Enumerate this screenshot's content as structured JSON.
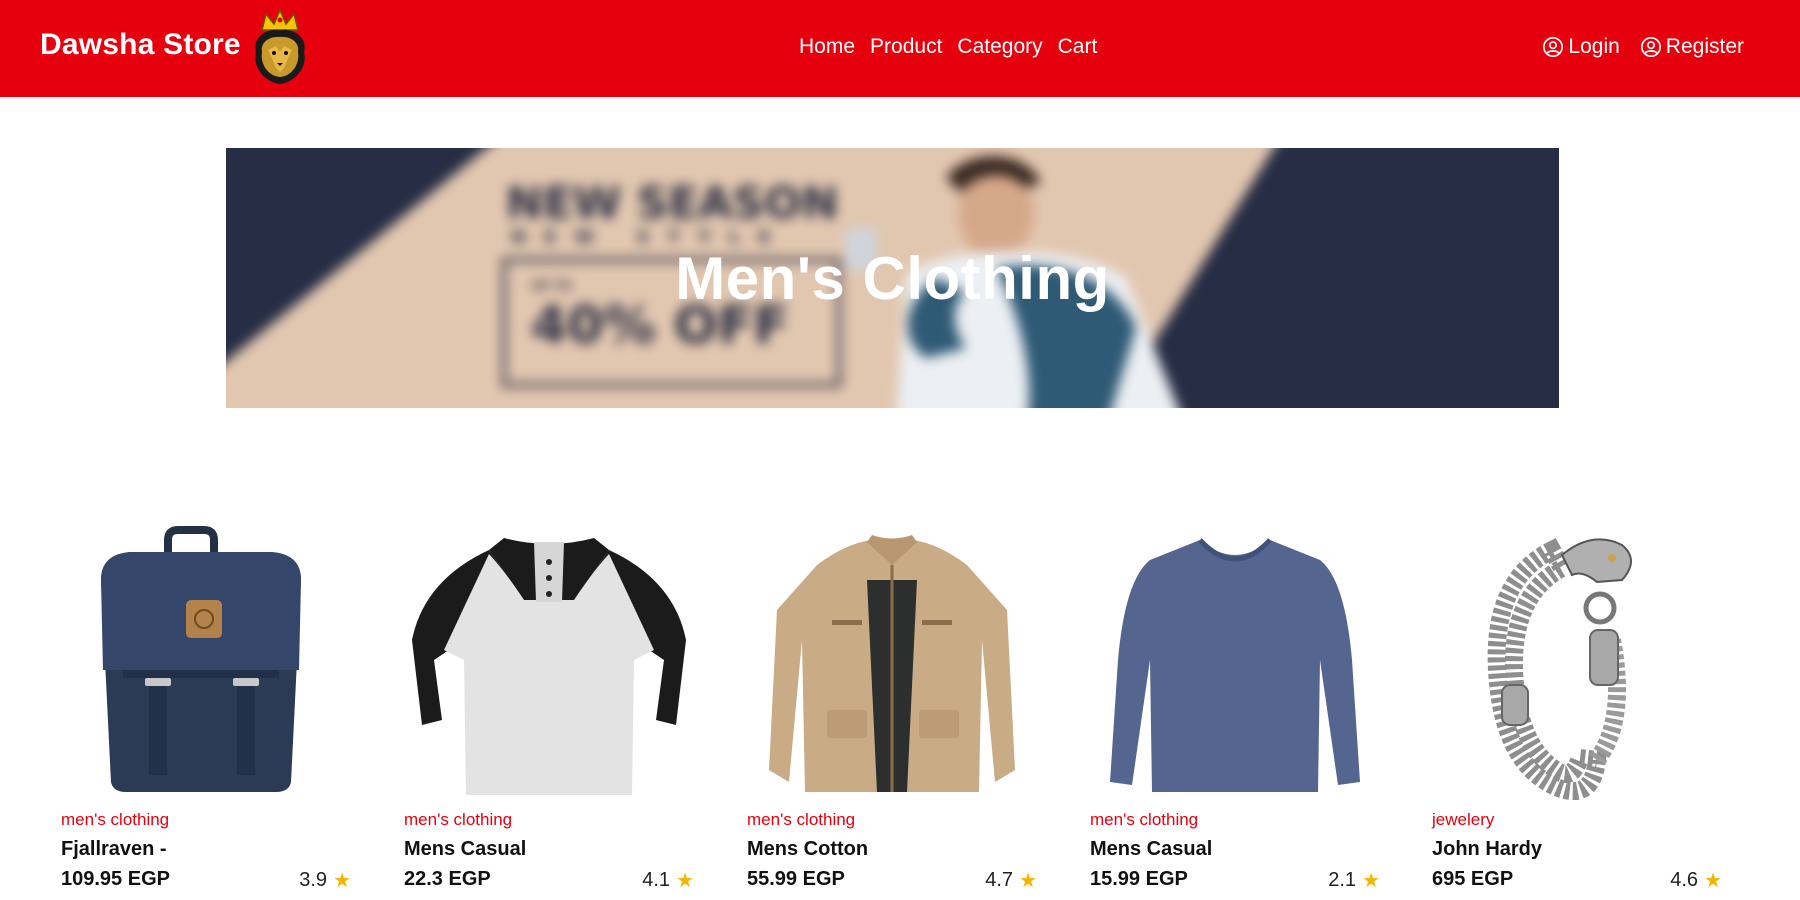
{
  "brand": {
    "name": "Dawsha Store"
  },
  "nav": {
    "links": [
      "Home",
      "Product",
      "Category",
      "Cart"
    ]
  },
  "auth": {
    "login": "Login",
    "register": "Register"
  },
  "hero": {
    "title": "Men's Clothing",
    "background_text": {
      "headline": "NEW SEASON",
      "subline": "NEW STYLE",
      "small": "UP TO",
      "offer": "40% OFF"
    }
  },
  "products": [
    {
      "category": "men's clothing",
      "title": "Fjallraven -",
      "price": "109.95 EGP",
      "rating": "3.9",
      "icon": "backpack-image"
    },
    {
      "category": "men's clothing",
      "title": "Mens Casual",
      "price": "22.3 EGP",
      "rating": "4.1",
      "icon": "raglan-shirt-image"
    },
    {
      "category": "men's clothing",
      "title": "Mens Cotton",
      "price": "55.99 EGP",
      "rating": "4.7",
      "icon": "jacket-image"
    },
    {
      "category": "men's clothing",
      "title": "Mens Casual",
      "price": "15.99 EGP",
      "rating": "2.1",
      "icon": "longsleeve-shirt-image"
    },
    {
      "category": "jewelery",
      "title": "John Hardy",
      "price": "695 EGP",
      "rating": "4.6",
      "icon": "bracelet-image"
    }
  ],
  "colors": {
    "primary": "#e6000e",
    "star": "#f5b400",
    "hero_navy": "#262d44",
    "hero_beige": "#e2c7b0"
  }
}
